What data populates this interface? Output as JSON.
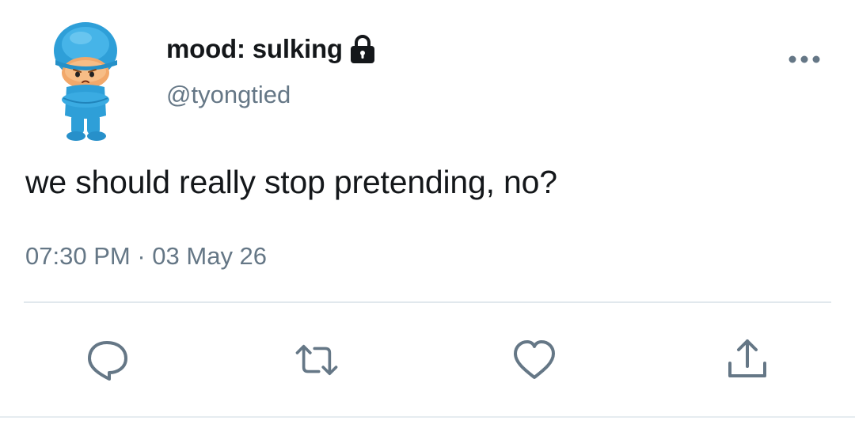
{
  "user": {
    "display_name": "mood: sulking",
    "handle": "@tyongtied",
    "avatar_icon": "cartoon-character-sulking-avatar",
    "protected_icon": "lock-icon"
  },
  "tweet": {
    "text": "we should really stop pretending, no?",
    "time": "07:30 PM",
    "separator": "·",
    "date": "03 May 26"
  },
  "actions": {
    "reply_icon": "reply-icon",
    "retweet_icon": "retweet-icon",
    "like_icon": "heart-icon",
    "share_icon": "share-icon"
  },
  "colors": {
    "text_primary": "#14171a",
    "text_secondary": "#657786",
    "icon_gray": "#657786",
    "avatar_blue": "#2da8e0"
  }
}
